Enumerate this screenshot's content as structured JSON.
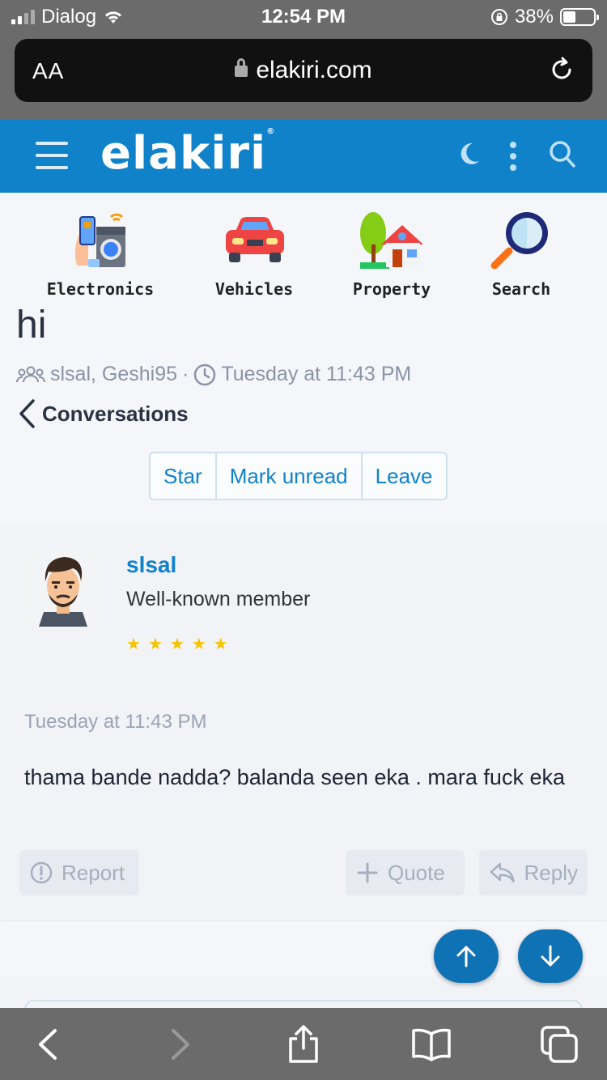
{
  "status_bar": {
    "carrier": "Dialog",
    "time": "12:54 PM",
    "battery_percent": "38%",
    "battery_level": 0.38
  },
  "browser": {
    "text_size_label": "AA",
    "url": "elakiri.com"
  },
  "site": {
    "logo_text": "elakiri"
  },
  "categories": [
    {
      "label": "Electronics",
      "icon": "electronics-icon"
    },
    {
      "label": "Vehicles",
      "icon": "car-icon"
    },
    {
      "label": "Property",
      "icon": "house-icon"
    },
    {
      "label": "Search",
      "icon": "magnifier-icon"
    }
  ],
  "conversation": {
    "title": "hi",
    "participants": "slsal, Geshi95",
    "separator": "·",
    "date": "Tuesday at 11:43 PM",
    "back_label": "Conversations",
    "actions": {
      "star": "Star",
      "mark_unread": "Mark unread",
      "leave": "Leave"
    }
  },
  "message": {
    "username": "slsal",
    "user_title": "Well-known member",
    "star_count": 5,
    "date": "Tuesday at 11:43 PM",
    "body": "thama bande nadda? balanda seen eka . mara fuck eka",
    "report_label": "Report",
    "quote_label": "Quote",
    "reply_label": "Reply"
  },
  "colors": {
    "brand": "#0f82c9",
    "star": "#f5c400",
    "chrome": "#6b6b6b"
  }
}
